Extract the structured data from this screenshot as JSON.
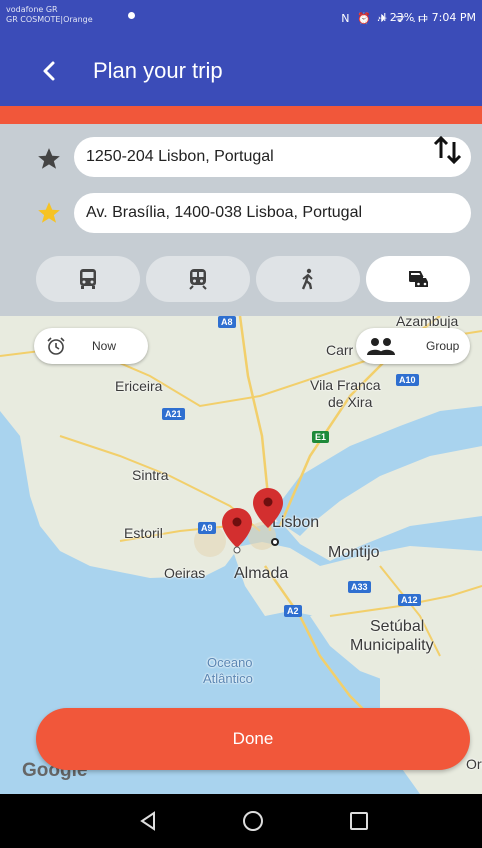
{
  "status_bar": {
    "carrier_line1": "vodafone GR",
    "carrier_line2": "GR COSMOTE|Orange",
    "icons": "N ⏰ ✈ ᯤ .ıl",
    "battery": ".ıl 23%",
    "time": "7:04 PM"
  },
  "app_bar": {
    "title": "Plan your trip",
    "back_icon": "chevron-left-icon"
  },
  "origin": {
    "value": "1250-204 Lisbon, Portugal",
    "icon": "star-icon-dark"
  },
  "destination": {
    "value": "Av. Brasília, 1400-038 Lisboa, Portugal",
    "icon": "star-icon-yellow"
  },
  "transport_modes": [
    {
      "name": "bus",
      "active": false
    },
    {
      "name": "train",
      "active": false
    },
    {
      "name": "walk",
      "active": false
    },
    {
      "name": "car-share",
      "active": true
    }
  ],
  "time_chip": {
    "label": "Now",
    "icon": "alarm-clock-icon"
  },
  "group_chip": {
    "label": "Group",
    "icon": "group-icon"
  },
  "map": {
    "places": [
      "Azambuja",
      "Carr",
      "Vila Franca",
      "de Xira",
      "Ericeira",
      "Sintra",
      "Estoril",
      "Oeiras",
      "Almada",
      "Montijo",
      "Setúbal",
      "Municipality",
      "Oceano",
      "Atlântico",
      "Ort",
      "Lisbon"
    ],
    "roads": [
      "A8",
      "A10",
      "A21",
      "E1",
      "A9",
      "A33",
      "A2",
      "A12"
    ]
  },
  "done_label": "Done",
  "google_logo": "Google",
  "colors": {
    "primary": "#3b4cb8",
    "accent": "#f1573a",
    "panel": "#c6cdd3",
    "pin": "#d32f2f"
  }
}
